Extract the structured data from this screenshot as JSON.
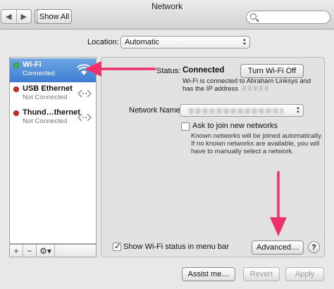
{
  "window": {
    "title": "Network"
  },
  "toolbar": {
    "back_label": "◀",
    "forward_label": "▶",
    "show_all_label": "Show All",
    "search_placeholder": ""
  },
  "location": {
    "label": "Location:",
    "value": "Automatic"
  },
  "services": [
    {
      "name": "Wi-Fi",
      "status": "Connected",
      "dot_color": "#3fbf3f",
      "icon": "wifi-icon",
      "selected": true
    },
    {
      "name": "USB Ethernet",
      "status": "Not Connected",
      "dot_color": "#d42a2a",
      "icon": "ethernet-arrows-icon",
      "selected": false
    },
    {
      "name": "Thund…thernet",
      "status": "Not Connected",
      "dot_color": "#d42a2a",
      "icon": "ethernet-arrows-icon",
      "selected": false
    }
  ],
  "sidebar_actions": {
    "add": "+",
    "remove": "−",
    "gear": "⚙▾"
  },
  "detail": {
    "status_label": "Status:",
    "status_value": "Connected",
    "toggle_wifi_label": "Turn Wi-Fi Off",
    "status_desc_1": "Wi-Fi is connected to Abraham Linksys and",
    "status_desc_2": "has the IP address",
    "network_name_label": "Network Name:",
    "ask_join_label": "Ask to join new networks",
    "ask_join_checked": false,
    "ask_desc_1": "Known networks will be joined automatically.",
    "ask_desc_2": "If no known networks are available, you will",
    "ask_desc_3": "have to manually select a network.",
    "show_status_label": "Show Wi-Fi status in menu bar",
    "show_status_checked": true,
    "advanced_label": "Advanced…",
    "help_label": "?"
  },
  "footer": {
    "assist_label": "Assist me…",
    "revert_label": "Revert",
    "apply_label": "Apply"
  },
  "colors": {
    "annotation_arrow": "#f0306a",
    "selection": "#3c7cd2"
  }
}
